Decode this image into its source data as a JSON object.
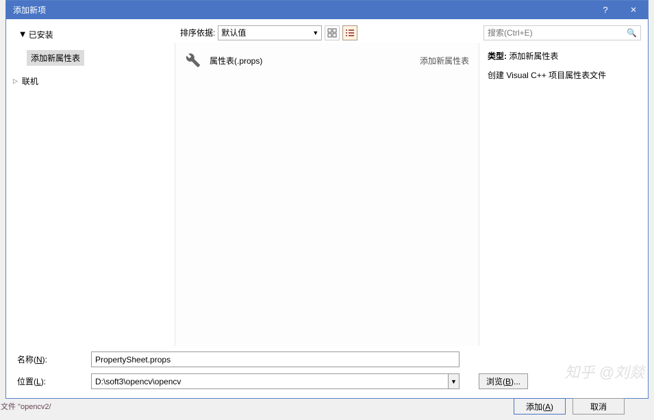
{
  "titlebar": {
    "title": "添加新项",
    "help": "?",
    "close": "×"
  },
  "toolbar": {
    "installed": "已安装",
    "sort_label": "排序依据:",
    "sort_value": "默认值",
    "search_placeholder": "搜索(Ctrl+E)"
  },
  "tree": {
    "items": [
      {
        "label": "添加新属性表",
        "selected": true
      }
    ],
    "online_label": "联机"
  },
  "list": {
    "items": [
      {
        "icon": "wrench",
        "label": "属性表(.props)",
        "category": "添加新属性表"
      }
    ]
  },
  "info": {
    "type_label": "类型:",
    "type_value": "添加新属性表",
    "desc": "创建 Visual C++ 项目属性表文件"
  },
  "fields": {
    "name_label": "名称(N):",
    "name_value": "PropertySheet.props",
    "location_label": "位置(L):",
    "location_value": "D:\\soft3\\opencv\\opencv",
    "browse_label": "浏览(B)..."
  },
  "buttons": {
    "add": "添加(A)",
    "cancel": "取消"
  },
  "watermark": "知乎 @刘燚",
  "bg_fragments": {
    "file_text": "文件 \"opencv2/"
  }
}
